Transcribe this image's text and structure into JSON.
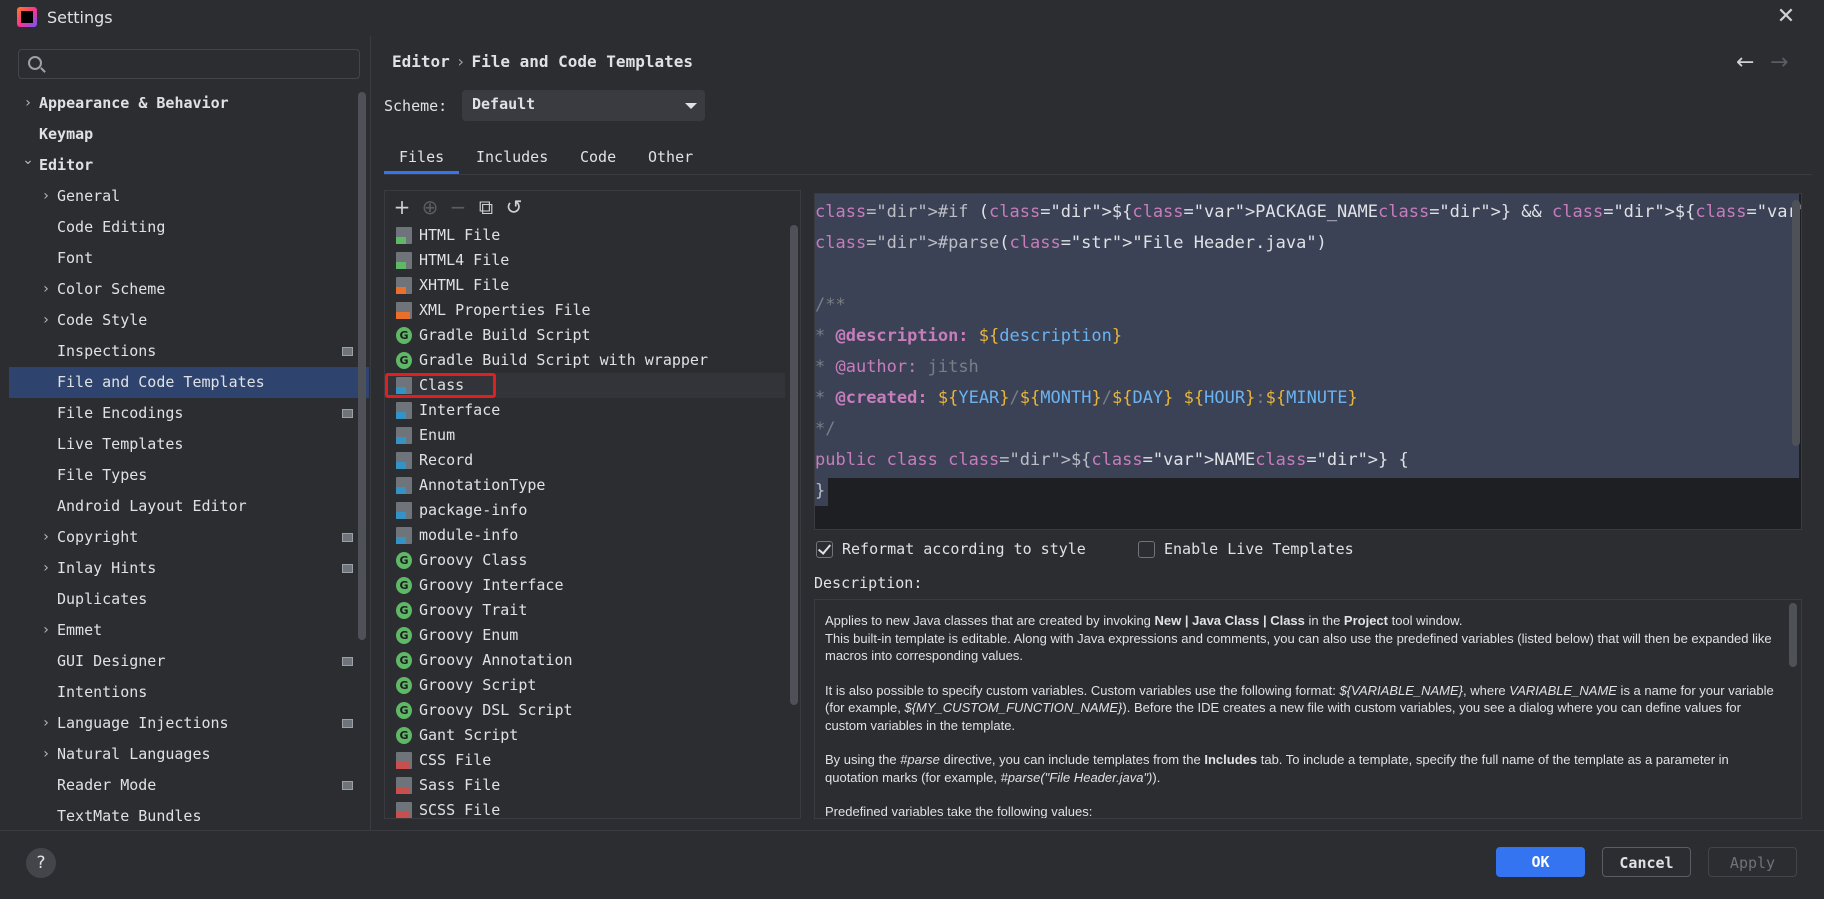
{
  "window": {
    "title": "Settings"
  },
  "search": {
    "placeholder": "",
    "value": ""
  },
  "sidebar": {
    "items": [
      {
        "label": "Appearance & Behavior",
        "bold": true,
        "chevron": "right"
      },
      {
        "label": "Keymap",
        "bold": true
      },
      {
        "label": "Editor",
        "bold": true,
        "chevron": "down"
      },
      {
        "label": "General",
        "chevron": "right"
      },
      {
        "label": "Code Editing"
      },
      {
        "label": "Font"
      },
      {
        "label": "Color Scheme",
        "chevron": "right"
      },
      {
        "label": "Code Style",
        "chevron": "right"
      },
      {
        "label": "Inspections",
        "pinned": true
      },
      {
        "label": "File and Code Templates",
        "selected": true
      },
      {
        "label": "File Encodings",
        "pinned": true
      },
      {
        "label": "Live Templates"
      },
      {
        "label": "File Types"
      },
      {
        "label": "Android Layout Editor"
      },
      {
        "label": "Copyright",
        "chevron": "right",
        "pinned": true
      },
      {
        "label": "Inlay Hints",
        "chevron": "right",
        "pinned": true
      },
      {
        "label": "Duplicates"
      },
      {
        "label": "Emmet",
        "chevron": "right"
      },
      {
        "label": "GUI Designer",
        "pinned": true
      },
      {
        "label": "Intentions"
      },
      {
        "label": "Language Injections",
        "chevron": "right",
        "pinned": true
      },
      {
        "label": "Natural Languages",
        "chevron": "right"
      },
      {
        "label": "Reader Mode",
        "pinned": true
      },
      {
        "label": "TextMate Bundles"
      }
    ]
  },
  "header": {
    "breadcrumb_parent": "Editor",
    "breadcrumb_sep": "›",
    "breadcrumb_current": "File and Code Templates",
    "back_icon": "←",
    "forward_icon": "→"
  },
  "scheme": {
    "label": "Scheme:",
    "value": "Default"
  },
  "tabs": [
    {
      "label": "Files",
      "active": true
    },
    {
      "label": "Includes"
    },
    {
      "label": "Code"
    },
    {
      "label": "Other"
    }
  ],
  "toolbar": {
    "add": "+",
    "add_child": "⊕",
    "remove": "−",
    "copy": "⧉",
    "reset": "↺"
  },
  "templates": [
    {
      "label": "HTML File",
      "icon": "html"
    },
    {
      "label": "HTML4 File",
      "icon": "html"
    },
    {
      "label": "XHTML File",
      "icon": "xhtml"
    },
    {
      "label": "XML Properties File",
      "icon": "xml"
    },
    {
      "label": "Gradle Build Script",
      "icon": "groovy"
    },
    {
      "label": "Gradle Build Script with wrapper",
      "icon": "groovy"
    },
    {
      "label": "Class",
      "icon": "java",
      "selected": true
    },
    {
      "label": "Interface",
      "icon": "java"
    },
    {
      "label": "Enum",
      "icon": "java"
    },
    {
      "label": "Record",
      "icon": "java"
    },
    {
      "label": "AnnotationType",
      "icon": "java"
    },
    {
      "label": "package-info",
      "icon": "java"
    },
    {
      "label": "module-info",
      "icon": "java"
    },
    {
      "label": "Groovy Class",
      "icon": "groovy"
    },
    {
      "label": "Groovy Interface",
      "icon": "groovy"
    },
    {
      "label": "Groovy Trait",
      "icon": "groovy"
    },
    {
      "label": "Groovy Enum",
      "icon": "groovy"
    },
    {
      "label": "Groovy Annotation",
      "icon": "groovy"
    },
    {
      "label": "Groovy Script",
      "icon": "groovy"
    },
    {
      "label": "Groovy DSL Script",
      "icon": "groovy"
    },
    {
      "label": "Gant Script",
      "icon": "groovy"
    },
    {
      "label": "CSS File",
      "icon": "css"
    },
    {
      "label": "Sass File",
      "icon": "css"
    },
    {
      "label": "SCSS File",
      "icon": "css"
    }
  ],
  "groovy_icon_letter": "G",
  "editor": {
    "lines": [
      "#if (${PACKAGE_NAME} && ${PACKAGE_NAME} != \"\")package ${PACKAGE_NAME};#end",
      "#parse(\"File Header.java\")",
      "",
      "/**",
      "* @description: ${description}",
      "* @author: jitsh",
      "* @created: ${YEAR}/${MONTH}/${DAY} ${HOUR}:${MINUTE}",
      "*/",
      "public class ${NAME} {",
      "}"
    ]
  },
  "options": {
    "reformat_label": "Reformat according to style",
    "reformat_checked": true,
    "live_label": "Enable Live Templates",
    "live_checked": false
  },
  "description": {
    "label": "Description:",
    "p1a": "Applies to new Java classes that are created by invoking ",
    "p1b": "New | Java Class | Class",
    "p1c": " in the ",
    "p1d": "Project",
    "p1e": " tool window.",
    "p1f": "This built-in template is editable. Along with Java expressions and comments, you can also use the predefined variables (listed below) that will then be expanded like macros into corresponding values.",
    "p2a": "It is also possible to specify custom variables. Custom variables use the following format: ",
    "p2b": "${VARIABLE_NAME}",
    "p2c": ", where ",
    "p2d": "VARIABLE_NAME",
    "p2e": " is a name for your variable (for example, ",
    "p2f": "${MY_CUSTOM_FUNCTION_NAME}",
    "p2g": "). Before the IDE creates a new file with custom variables, you see a dialog where you can define values for custom variables in the template.",
    "p3a": "By using the ",
    "p3b": "#parse",
    "p3c": " directive, you can include templates from the ",
    "p3d": "Includes",
    "p3e": " tab. To include a template, specify the full name of the template as a parameter in quotation marks (for example, ",
    "p3f": "#parse(\"File Header.java\")",
    "p3g": ").",
    "p4": "Predefined variables take the following values:"
  },
  "footer": {
    "help": "?",
    "ok": "OK",
    "cancel": "Cancel",
    "apply": "Apply"
  },
  "colors": {
    "accent": "#3574f0",
    "selection": "#2e436e",
    "highlight_box": "#e02020"
  }
}
